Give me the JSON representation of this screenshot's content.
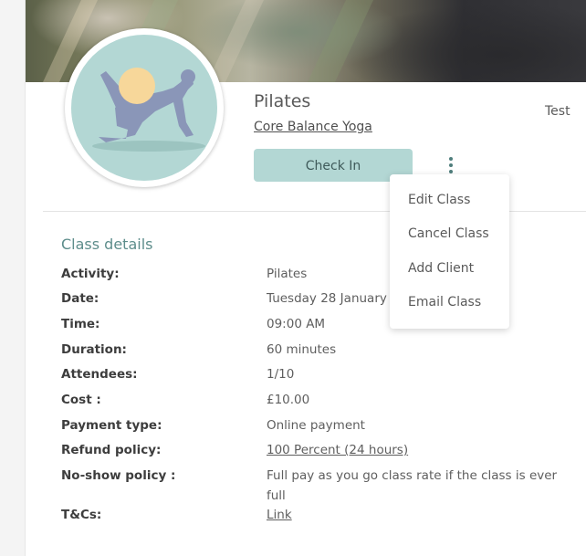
{
  "class_header": {
    "title": "Pilates",
    "studio": "Core Balance Yoga",
    "user": "Test",
    "checkin_label": "Check In"
  },
  "menu": {
    "items": [
      {
        "label": "Edit Class"
      },
      {
        "label": "Cancel Class"
      },
      {
        "label": "Add Client"
      },
      {
        "label": "Email Class"
      }
    ]
  },
  "details": {
    "section_title": "Class details",
    "rows": [
      {
        "label": "Activity:",
        "value": "Pilates"
      },
      {
        "label": "Date:",
        "value": "Tuesday 28 January"
      },
      {
        "label": "Time:",
        "value": "09:00 AM"
      },
      {
        "label": "Duration:",
        "value": "60 minutes"
      },
      {
        "label": "Attendees:",
        "value": "1/10"
      },
      {
        "label": "Cost :",
        "value": "£10.00"
      },
      {
        "label": "Payment type:",
        "value": "Online payment"
      },
      {
        "label": "Refund policy:",
        "value": "100 Percent (24 hours)"
      },
      {
        "label": "No-show policy :",
        "value": "Full pay as you go class rate if the class is ever full"
      },
      {
        "label": "T&Cs:",
        "value": "Link"
      }
    ]
  },
  "icons": {
    "avatar": "pilates-pose-illustration",
    "menu": "vertical-ellipsis-icon"
  },
  "colors": {
    "accent": "#5d8d8b",
    "button_bg": "#b3d7d4",
    "avatar_bg": "#b3d7d4",
    "figure": "#8a96b8",
    "ball": "#f7d79a"
  }
}
